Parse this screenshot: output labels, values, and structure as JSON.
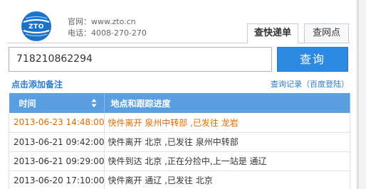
{
  "header": {
    "logo_text": "ZTO",
    "website_line": "官网：www.zto.cn",
    "phone_line": "电话：4008-270-270"
  },
  "tabs": [
    {
      "label": "查快递单",
      "active": true
    },
    {
      "label": "查网点",
      "active": false
    }
  ],
  "search": {
    "value": "718210862294",
    "button_label": "查询"
  },
  "links": {
    "add_note": "点击添加备注",
    "history": "查询记录（百度登陆）"
  },
  "table": {
    "headers": {
      "time": "时间",
      "place": "地点和跟踪进度"
    },
    "rows": [
      {
        "time": "2013-06-23 14:48:00",
        "status": "快件离开  泉州中转部  ,已发往  龙岩",
        "highlight": true
      },
      {
        "time": "2013-06-21 09:42:00",
        "status": "快件离开  北京  ,已发往  泉州中转部",
        "highlight": false
      },
      {
        "time": "2013-06-21 09:29:00",
        "status": "快件到达  北京  ,正在分捡中,上一站是  通辽",
        "highlight": false
      },
      {
        "time": "2013-06-20 17:10:00",
        "status": "快件离开  通辽  ,已发往  北京",
        "highlight": false
      }
    ]
  },
  "colors": {
    "accent": "#2c8ae0",
    "header_bg": "#5c9fe0",
    "latest_row": "#e06c00",
    "link": "#2a7bd0"
  }
}
